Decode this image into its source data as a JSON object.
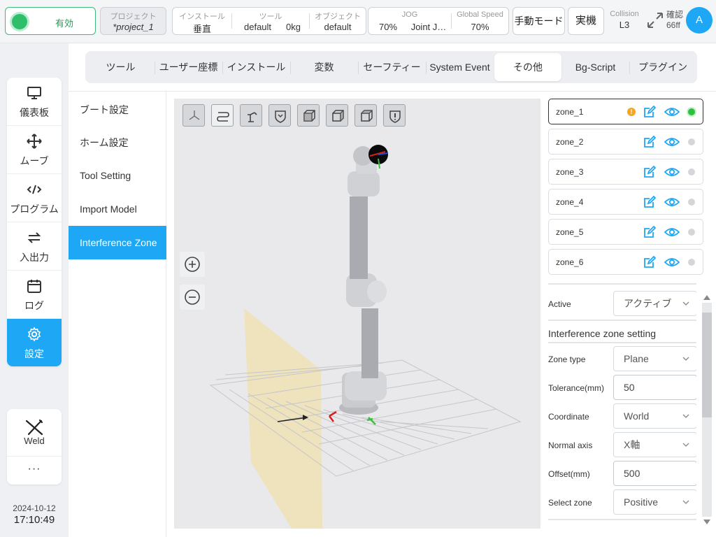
{
  "topbar": {
    "enable_label": "有効",
    "project_label": "プロジェクト",
    "project_value": "*project_1",
    "install_label": "インストール",
    "install_value": "垂直",
    "tool_label": "ツール",
    "tool_name": "default",
    "tool_weight": "0kg",
    "object_label": "オブジェクト",
    "object_value": "default",
    "jog_label": "JOG",
    "jog_speed": "70%",
    "jog_mode": "Joint J…",
    "global_speed_label": "Global Speed",
    "global_speed_value": "70%",
    "manual_mode_label": "手動モード",
    "real_label": "実機",
    "collision_label": "Collision",
    "collision_level": "L3",
    "confirm_label": "確認",
    "confirm_value": "66ff",
    "avatar_initial": "A"
  },
  "nav": {
    "items": [
      {
        "label": "儀表板",
        "icon": "monitor-icon"
      },
      {
        "label": "ムーブ",
        "icon": "move-icon"
      },
      {
        "label": "プログラム",
        "icon": "code-icon"
      },
      {
        "label": "入出力",
        "icon": "io-arrows-icon"
      },
      {
        "label": "ログ",
        "icon": "calendar-icon"
      },
      {
        "label": "設定",
        "icon": "gear-icon",
        "active": true
      }
    ],
    "weld_label": "Weld",
    "more_label": "···"
  },
  "clock": {
    "date": "2024-10-12",
    "time": "17:10:49"
  },
  "tabs": [
    {
      "label": "ツール"
    },
    {
      "label": "ユーザー座標"
    },
    {
      "label": "インストール"
    },
    {
      "label": "変数"
    },
    {
      "label": "セーフティー"
    },
    {
      "label": "System Event"
    },
    {
      "label": "その他",
      "active": true
    },
    {
      "label": "Bg-Script"
    },
    {
      "label": "プラグイン"
    }
  ],
  "submenu": [
    {
      "label": "ブート設定"
    },
    {
      "label": "ホーム設定"
    },
    {
      "label": "Tool Setting"
    },
    {
      "label": "Import Model"
    },
    {
      "label": "Interference Zone",
      "active": true
    }
  ],
  "viewport": {
    "toolbar_icons": [
      "axis-view-icon",
      "path-icon",
      "robot-model-icon",
      "shield-zone-icon",
      "front-view-icon",
      "side-view-icon",
      "top-view-icon",
      "shield-warning-icon"
    ],
    "zoom_in_icon": "zoom-in-icon",
    "zoom_out_icon": "zoom-out-icon"
  },
  "zones": [
    {
      "name": "zone_1",
      "warning": true,
      "active": true,
      "selected": true
    },
    {
      "name": "zone_2",
      "warning": false,
      "active": false
    },
    {
      "name": "zone_3",
      "warning": false,
      "active": false
    },
    {
      "name": "zone_4",
      "warning": false,
      "active": false
    },
    {
      "name": "zone_5",
      "warning": false,
      "active": false
    },
    {
      "name": "zone_6",
      "warning": false,
      "active": false
    }
  ],
  "form": {
    "active_label": "Active",
    "active_value": "アクティブ",
    "section_title": "Interference zone setting",
    "zone_type_label": "Zone type",
    "zone_type_value": "Plane",
    "tolerance_label": "Tolerance(mm)",
    "tolerance_value": "50",
    "coordinate_label": "Coordinate",
    "coordinate_value": "World",
    "normal_axis_label": "Normal axis",
    "normal_axis_value": "X軸",
    "offset_label": "Offset(mm)",
    "offset_value": "500",
    "select_zone_label": "Select zone",
    "select_zone_value": "Positive"
  },
  "colors": {
    "accent": "#1ea7f4",
    "enabled_green": "#2fbf6b",
    "warning": "#f5a623",
    "zone_plane": "#efe2b8"
  }
}
